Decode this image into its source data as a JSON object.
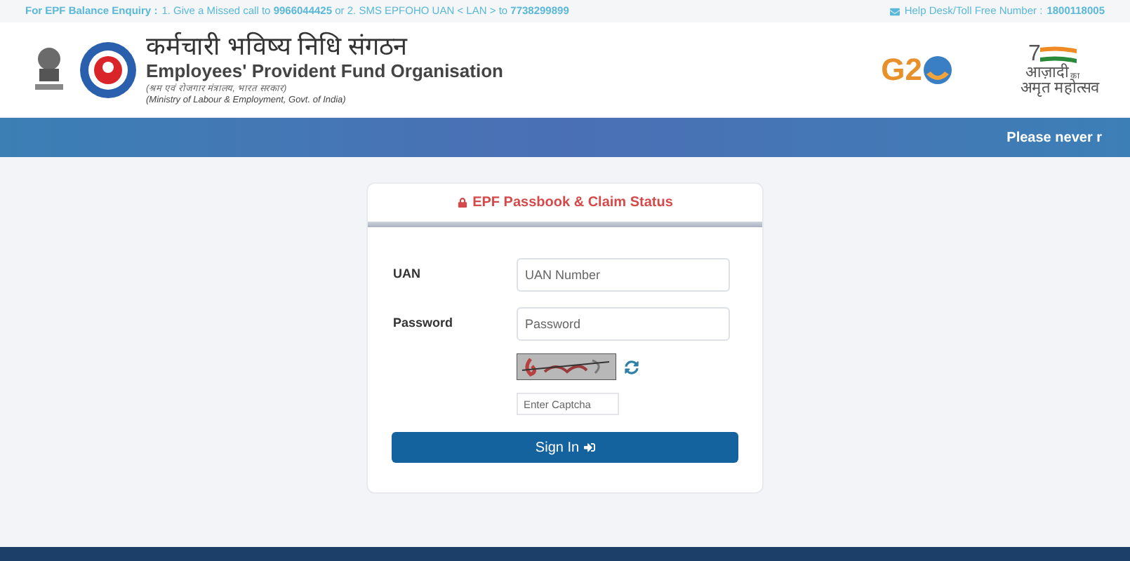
{
  "top_bar": {
    "enquiry_label": "For EPF Balance Enquiry :",
    "enquiry_text": "1. Give a Missed call to **9966044425** or 2. SMS EPFOHO UAN < LAN > to **7738299899**",
    "helpdesk_label": "Help Desk/Toll Free Number :",
    "helpdesk_number": "1800118005"
  },
  "header": {
    "title_hindi": "कर्मचारी भविष्य निधि संगठन",
    "title": "Employees' Provident Fund Organisation",
    "subtitle_hindi": "(श्रम एवं रोजगार मंत्रालय, भारत सरकार)",
    "subtitle": "(Ministry of Labour & Employment, Govt. of India)",
    "g20_text": "G2",
    "azadi_number": "7",
    "azadi_line1": "आज़ादी",
    "azadi_line1_small": "का",
    "azadi_line2": "अमृत महोत्सव"
  },
  "banner": {
    "ticker": "Please never r"
  },
  "login_card": {
    "title": "EPF Passbook & Claim Status",
    "fields": [
      {
        "label": "UAN",
        "placeholder": "UAN Number"
      },
      {
        "label": "Password",
        "placeholder": "Password"
      }
    ],
    "captcha_placeholder": "Enter Captcha",
    "button": "Sign In"
  }
}
